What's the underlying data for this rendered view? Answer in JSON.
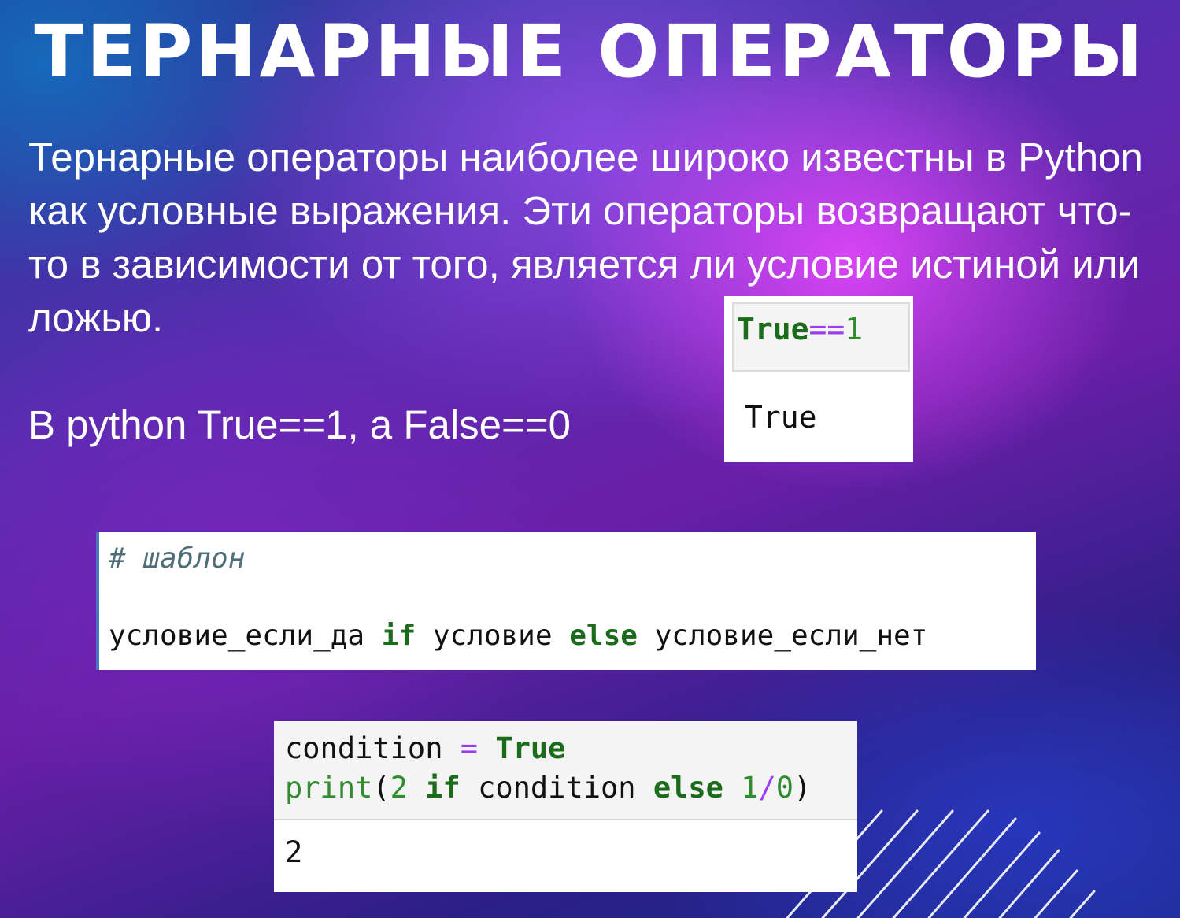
{
  "title": "Тернарные операторы",
  "paragraph": "Тернарные операторы наиболее широко известны в Python как условные выражения. Эти операторы возвращают что-то в зависимости от того, является ли условие истиной или ложью.",
  "equivalence": "В python True==1, а False==0",
  "true_cell": {
    "code_kw": "True",
    "code_op": "==",
    "code_num": "1",
    "output": "True"
  },
  "template_cell": {
    "comment": "# шаблон",
    "part1": "условие_если_да ",
    "kw_if": "if",
    "part2": " условие ",
    "kw_else": "else",
    "part3": " условие_если_нет"
  },
  "condition_cell": {
    "line1_name": "condition ",
    "line1_op": "=",
    "line1_sp": " ",
    "line1_kw": "True",
    "line2_func": "print",
    "line2_paren": "(",
    "line2_num": "2",
    "line2_sp1": " ",
    "line2_if": "if",
    "line2_mid": " condition ",
    "line2_else": "else",
    "line2_sp2": " ",
    "line2_num1": "1",
    "line2_div": "/",
    "line2_num0": "0",
    "line2_close": ")",
    "output": "2"
  },
  "colors": {
    "keyword": "#1a6b1a",
    "operator": "#9a3df0",
    "number": "#2f8c2f",
    "comment": "#4f6f78"
  }
}
